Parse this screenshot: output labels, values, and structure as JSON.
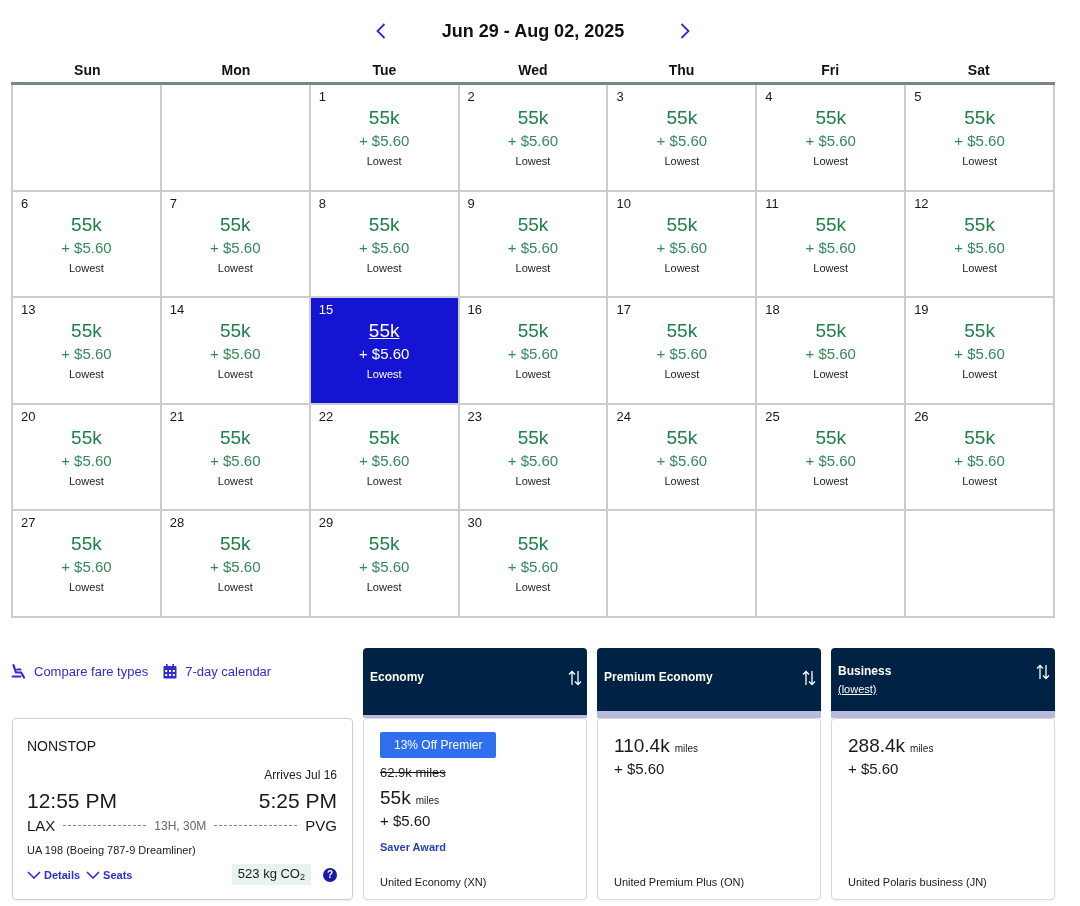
{
  "header": {
    "title": "Jun 29 - Aug 02, 2025"
  },
  "calendar": {
    "weekdays": [
      "Sun",
      "Mon",
      "Tue",
      "Wed",
      "Thu",
      "Fri",
      "Sat"
    ],
    "weeks": [
      [
        {
          "kind": "blank"
        },
        {
          "kind": "blank"
        },
        {
          "kind": "day",
          "day": "1",
          "miles": "55k",
          "fee": "+ $5.60",
          "note": "Lowest",
          "selected": false
        },
        {
          "kind": "day",
          "day": "2",
          "miles": "55k",
          "fee": "+ $5.60",
          "note": "Lowest",
          "selected": false
        },
        {
          "kind": "day",
          "day": "3",
          "miles": "55k",
          "fee": "+ $5.60",
          "note": "Lowest",
          "selected": false
        },
        {
          "kind": "day",
          "day": "4",
          "miles": "55k",
          "fee": "+ $5.60",
          "note": "Lowest",
          "selected": false
        },
        {
          "kind": "day",
          "day": "5",
          "miles": "55k",
          "fee": "+ $5.60",
          "note": "Lowest",
          "selected": false
        }
      ],
      [
        {
          "kind": "day",
          "day": "6",
          "miles": "55k",
          "fee": "+ $5.60",
          "note": "Lowest",
          "selected": false
        },
        {
          "kind": "day",
          "day": "7",
          "miles": "55k",
          "fee": "+ $5.60",
          "note": "Lowest",
          "selected": false
        },
        {
          "kind": "day",
          "day": "8",
          "miles": "55k",
          "fee": "+ $5.60",
          "note": "Lowest",
          "selected": false
        },
        {
          "kind": "day",
          "day": "9",
          "miles": "55k",
          "fee": "+ $5.60",
          "note": "Lowest",
          "selected": false
        },
        {
          "kind": "day",
          "day": "10",
          "miles": "55k",
          "fee": "+ $5.60",
          "note": "Lowest",
          "selected": false
        },
        {
          "kind": "day",
          "day": "11",
          "miles": "55k",
          "fee": "+ $5.60",
          "note": "Lowest",
          "selected": false
        },
        {
          "kind": "day",
          "day": "12",
          "miles": "55k",
          "fee": "+ $5.60",
          "note": "Lowest",
          "selected": false
        }
      ],
      [
        {
          "kind": "day",
          "day": "13",
          "miles": "55k",
          "fee": "+ $5.60",
          "note": "Lowest",
          "selected": false
        },
        {
          "kind": "day",
          "day": "14",
          "miles": "55k",
          "fee": "+ $5.60",
          "note": "Lowest",
          "selected": false
        },
        {
          "kind": "day",
          "day": "15",
          "miles": "55k",
          "fee": "+ $5.60",
          "note": "Lowest",
          "selected": true
        },
        {
          "kind": "day",
          "day": "16",
          "miles": "55k",
          "fee": "+ $5.60",
          "note": "Lowest",
          "selected": false
        },
        {
          "kind": "day",
          "day": "17",
          "miles": "55k",
          "fee": "+ $5.60",
          "note": "Lowest",
          "selected": false
        },
        {
          "kind": "day",
          "day": "18",
          "miles": "55k",
          "fee": "+ $5.60",
          "note": "Lowest",
          "selected": false
        },
        {
          "kind": "day",
          "day": "19",
          "miles": "55k",
          "fee": "+ $5.60",
          "note": "Lowest",
          "selected": false
        }
      ],
      [
        {
          "kind": "day",
          "day": "20",
          "miles": "55k",
          "fee": "+ $5.60",
          "note": "Lowest",
          "selected": false
        },
        {
          "kind": "day",
          "day": "21",
          "miles": "55k",
          "fee": "+ $5.60",
          "note": "Lowest",
          "selected": false
        },
        {
          "kind": "day",
          "day": "22",
          "miles": "55k",
          "fee": "+ $5.60",
          "note": "Lowest",
          "selected": false
        },
        {
          "kind": "day",
          "day": "23",
          "miles": "55k",
          "fee": "+ $5.60",
          "note": "Lowest",
          "selected": false
        },
        {
          "kind": "day",
          "day": "24",
          "miles": "55k",
          "fee": "+ $5.60",
          "note": "Lowest",
          "selected": false
        },
        {
          "kind": "day",
          "day": "25",
          "miles": "55k",
          "fee": "+ $5.60",
          "note": "Lowest",
          "selected": false
        },
        {
          "kind": "day",
          "day": "26",
          "miles": "55k",
          "fee": "+ $5.60",
          "note": "Lowest",
          "selected": false
        }
      ],
      [
        {
          "kind": "day",
          "day": "27",
          "miles": "55k",
          "fee": "+ $5.60",
          "note": "Lowest",
          "selected": false
        },
        {
          "kind": "day",
          "day": "28",
          "miles": "55k",
          "fee": "+ $5.60",
          "note": "Lowest",
          "selected": false
        },
        {
          "kind": "day",
          "day": "29",
          "miles": "55k",
          "fee": "+ $5.60",
          "note": "Lowest",
          "selected": false
        },
        {
          "kind": "day",
          "day": "30",
          "miles": "55k",
          "fee": "+ $5.60",
          "note": "Lowest",
          "selected": false
        },
        {
          "kind": "blank"
        },
        {
          "kind": "blank"
        },
        {
          "kind": "blank"
        }
      ]
    ]
  },
  "links": [
    {
      "label": "Compare fare types"
    },
    {
      "label": "7-day calendar"
    }
  ],
  "flight": {
    "stop_label": "NONSTOP",
    "arrival_note": "Arrives Jul 16",
    "depart_time": "12:55 PM",
    "arrive_time": "5:25 PM",
    "origin": "LAX",
    "duration": "13H, 30M",
    "destination": "PVG",
    "flight_info": "UA 198 (Boeing 787-9 Dreamliner)",
    "toggles": [
      "Details",
      "Seats"
    ],
    "emissions": "523 kg CO$_{2}$",
    "help": "?"
  },
  "fares": [
    {
      "cabin": "Economy",
      "selected": true,
      "badge": "13% Off Premier",
      "original_miles": "62.9k miles",
      "miles": "55k",
      "miles_unit": "miles",
      "fee": "+ $5.60",
      "award": "Saver Award",
      "fare_class": "United Economy (XN)"
    },
    {
      "cabin": "Premium Economy",
      "selected": false,
      "miles": "110.4k",
      "miles_unit": "miles",
      "fee": "+ $5.60",
      "fare_class": "United Premium Plus (ON)"
    },
    {
      "cabin": "Business",
      "subtitle": "(lowest)",
      "selected": false,
      "miles": "288.4k",
      "miles_unit": "miles",
      "fee": "+ $5.60",
      "fare_class": "United Polaris business (JN)"
    }
  ]
}
